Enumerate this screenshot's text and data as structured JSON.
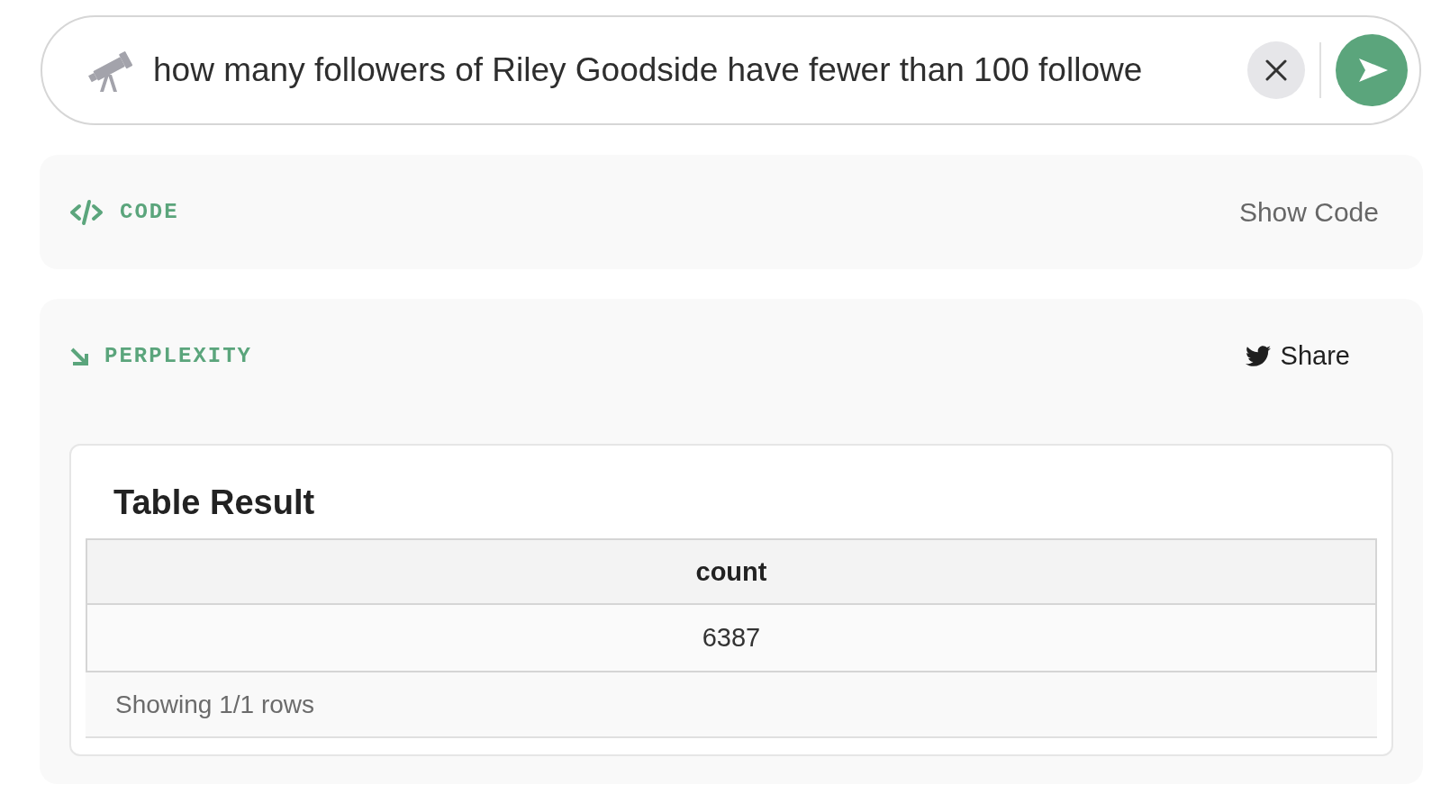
{
  "search": {
    "value": "how many followers of Riley Goodside have fewer than 100 followe"
  },
  "panels": [
    {
      "kind": "code",
      "label": "CODE",
      "action": "Show Code"
    },
    {
      "kind": "answer",
      "label": "PERPLEXITY",
      "action": "Share",
      "table": {
        "title": "Table Result",
        "columns": [
          "count"
        ],
        "rows": [
          [
            "6387"
          ]
        ],
        "footer": "Showing 1/1 rows"
      }
    }
  ]
}
